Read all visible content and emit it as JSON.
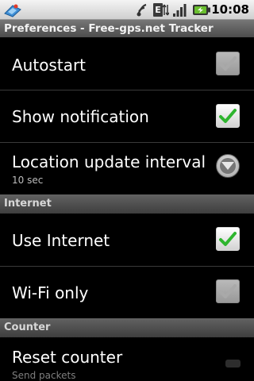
{
  "status_bar": {
    "time": "10:08",
    "network_type": "E",
    "icons": [
      "app-icon",
      "gps-icon",
      "edge-network-icon",
      "signal-icon",
      "battery-charging-icon"
    ]
  },
  "title_bar": {
    "title": "Preferences - Free-gps.net Tracker"
  },
  "preferences": [
    {
      "key": "autostart",
      "title": "Autostart",
      "control": "checkbox",
      "checked": true,
      "enabled": false
    },
    {
      "key": "show_notification",
      "title": "Show notification",
      "control": "checkbox",
      "checked": true,
      "enabled": true
    },
    {
      "key": "location_update_interval",
      "title": "Location update interval",
      "summary": "10 sec",
      "control": "dropdown"
    }
  ],
  "category_internet": {
    "label": "Internet",
    "items": [
      {
        "key": "use_internet",
        "title": "Use Internet",
        "control": "checkbox",
        "checked": true,
        "enabled": true
      },
      {
        "key": "wifi_only",
        "title": "Wi-Fi only",
        "control": "checkbox",
        "checked": true,
        "enabled": false
      }
    ]
  },
  "category_counter": {
    "label": "Counter",
    "items": [
      {
        "key": "reset_counter",
        "title": "Reset counter",
        "summary": "Send packets"
      }
    ]
  },
  "colors": {
    "check_green": "#2fb52f",
    "check_disabled": "#9a9a9a",
    "background": "#000000",
    "category_bg": "#4f4f4f"
  }
}
